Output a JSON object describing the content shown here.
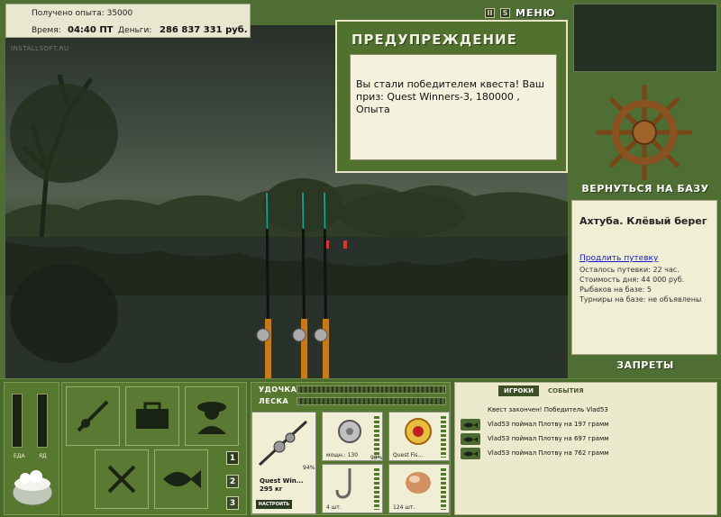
{
  "info": {
    "exp_label": "Получено опыта: 35000",
    "time_label": "Время:",
    "time_value": "04:40 ПТ",
    "money_label": "Деньги:",
    "money_value": "286 837 331 руб."
  },
  "watermark": "INSTALLSOFT.RU",
  "nav": {
    "pause": "II",
    "sound": "S",
    "menu": "МЕНЮ"
  },
  "warning": {
    "title": "ПРЕДУПРЕЖДЕНИЕ",
    "message": "Вы стали победителем квеста! Ваш приз: Quest Winners-3, 180000 , Опыта"
  },
  "right": {
    "return_label": "ВЕРНУТЬСЯ НА БАЗУ",
    "location_title": "Ахтуба. Клёвый берег",
    "extend_link": "Продлить путевку",
    "lines": [
      "Осталось путевки: 22 час.",
      "Стоимость дня: 44 000 руб.",
      "Рыбаков на базе: 5",
      "Турниры на базе: не объявлены"
    ],
    "bans_label": "ЗАПРЕТЫ"
  },
  "status": {
    "food_label": "ЕДА",
    "poison_label": "ЯД"
  },
  "tabs": [
    "1",
    "2",
    "3"
  ],
  "tackle": {
    "rod_label": "УДОЧКА",
    "line_label": "ЛЕСКА",
    "rod_name": "Quest Win...",
    "rod_weight": "295 кг",
    "rod_percent": "94%",
    "setup_label": "НАСТРОИТЬ",
    "reel_power": "мощн.: 130",
    "reel_percent": "98%",
    "line_name": "Quest Fis...",
    "hooks_count": "4 шт.",
    "bait_count": "124 шт."
  },
  "events": {
    "tab_players": "ИГРОКИ",
    "tab_events": "СОБЫТИЯ",
    "items": [
      "Квест закончен! Победитель Vlad53",
      "Vlad53 поймал Плотву на 197 грамм",
      "Vlad53 поймал Плотву на 697 грамм",
      "Vlad53 поймал Плотву на 762 грамм"
    ]
  },
  "colors": {
    "panel_green": "#57782f",
    "accent": "#e8e4c8"
  }
}
